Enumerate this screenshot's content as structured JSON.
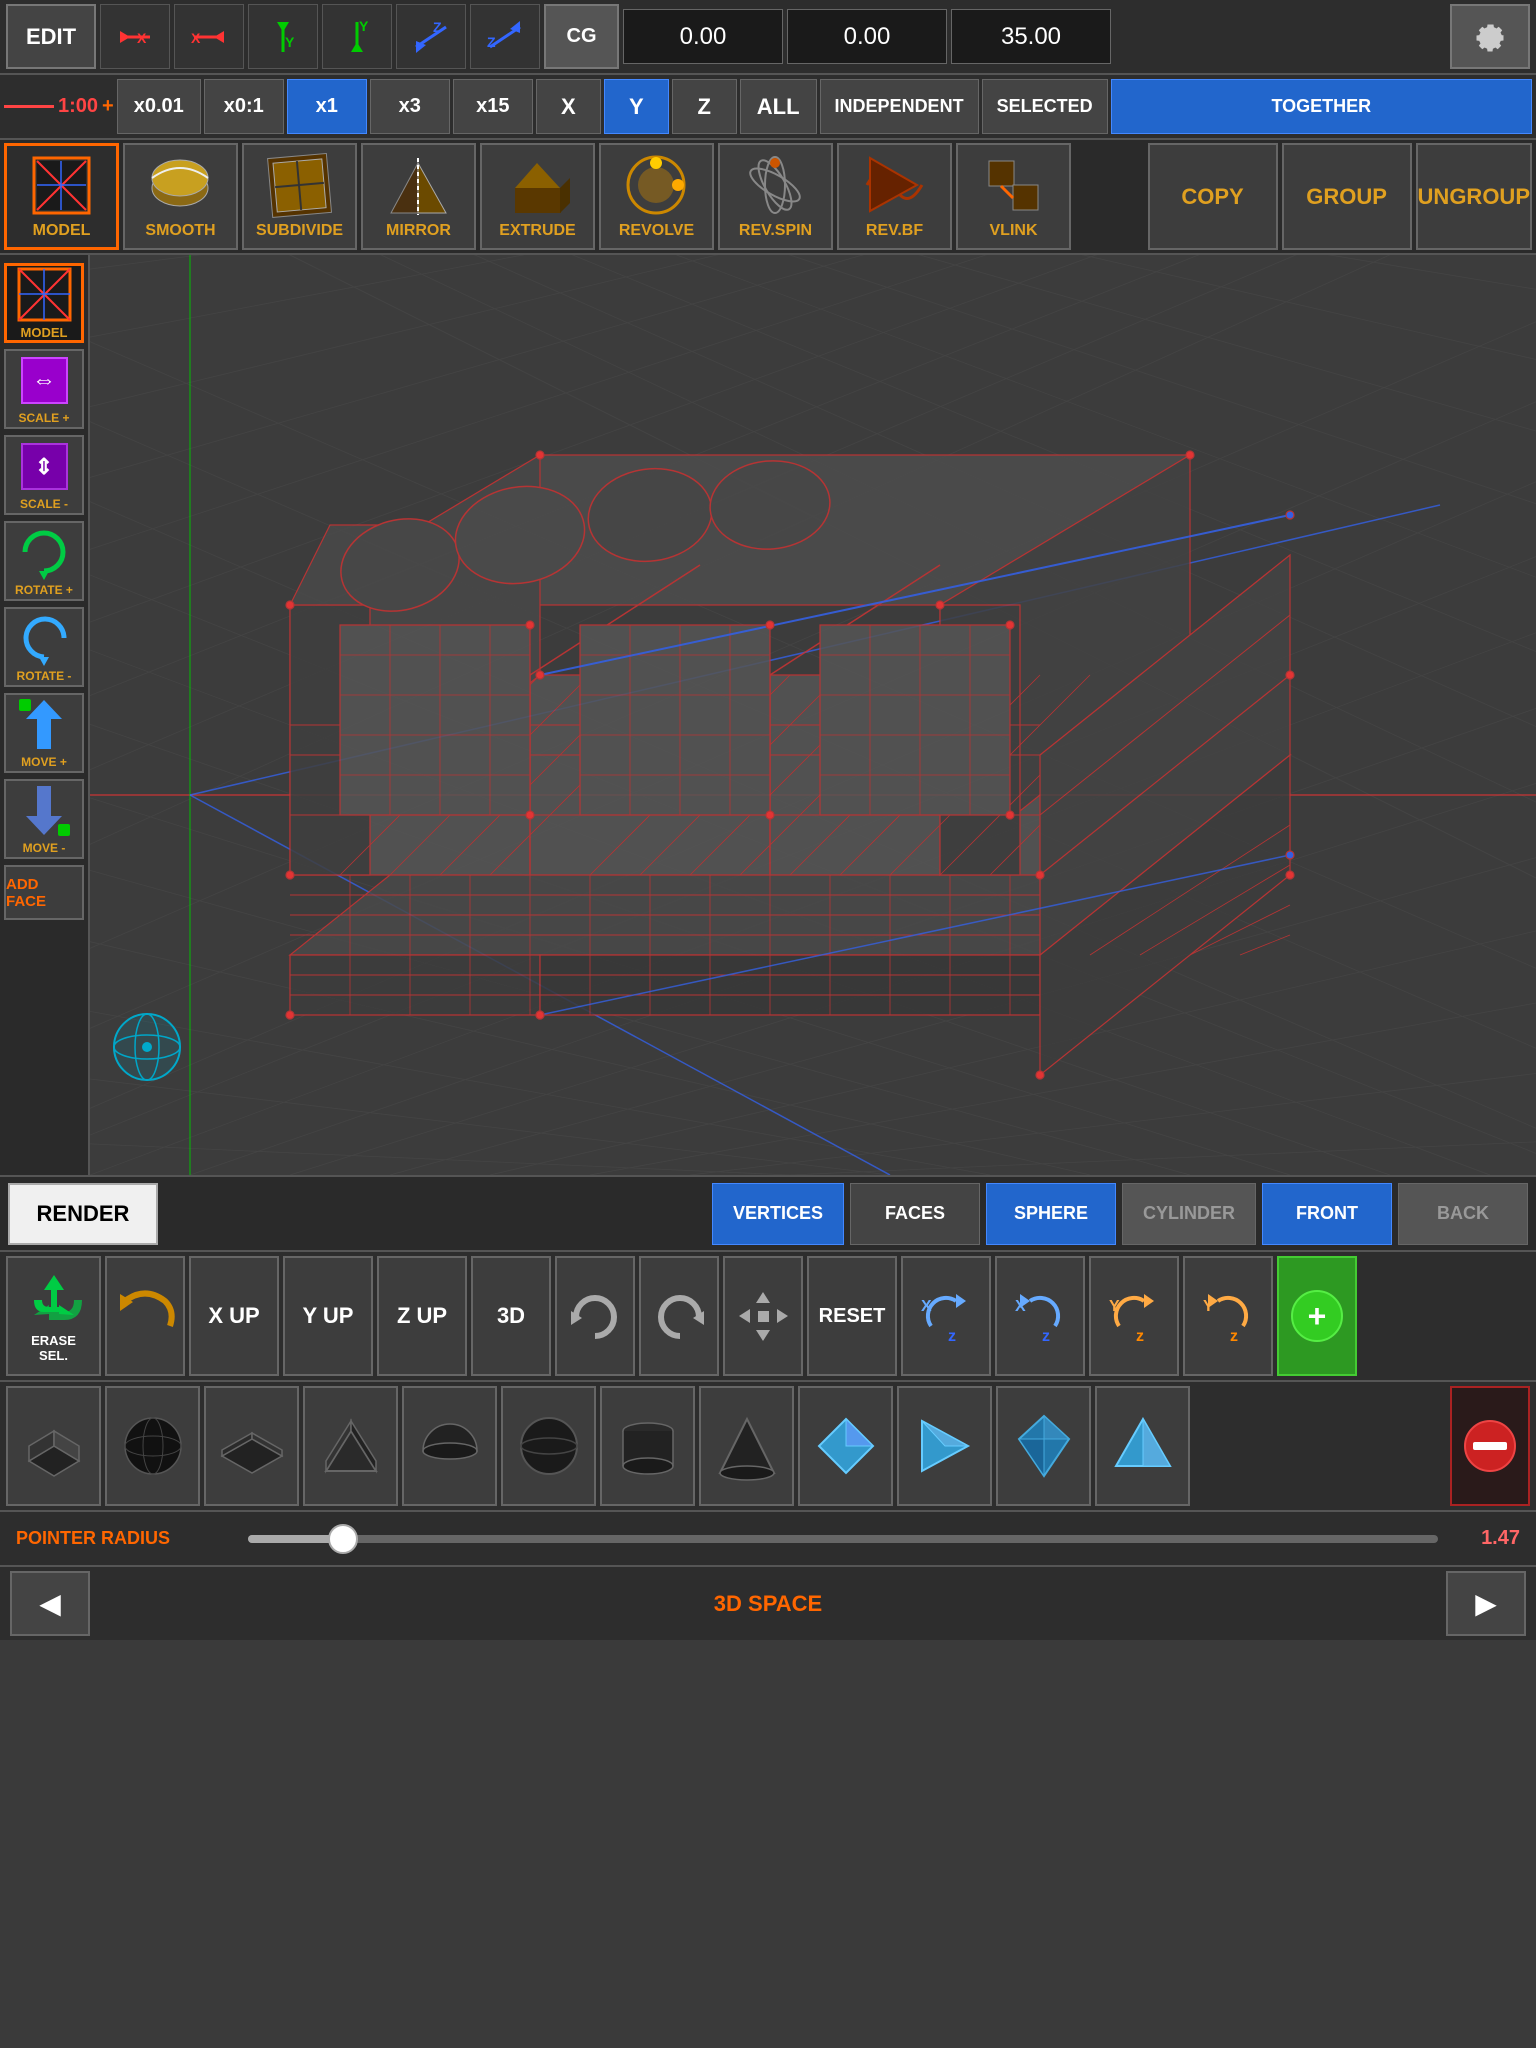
{
  "header": {
    "edit_label": "EDIT",
    "cg_label": "CG",
    "x_coord": "0.00",
    "y_coord": "0.00",
    "z_coord": "35.00",
    "axis_x_neg": "X",
    "axis_x_pos": "X",
    "axis_y_neg": "Y",
    "axis_y_pos": "Y",
    "axis_z_neg": "Z",
    "axis_z_pos": "Z"
  },
  "second_bar": {
    "scale": "1:00",
    "mult_options": [
      "x0.01",
      "x0:1",
      "x1",
      "x3",
      "x15"
    ],
    "active_mult": "x1",
    "axes": [
      "X",
      "Y",
      "Z",
      "ALL"
    ],
    "active_axis": "Y",
    "modes": [
      "INDEPENDENT",
      "SELECTED",
      "TOGETHER"
    ],
    "active_mode": "TOGETHER"
  },
  "toolbar": {
    "tools": [
      "MODEL",
      "SMOOTH",
      "SUBDIVIDE",
      "MIRROR",
      "EXTRUDE",
      "REVOLVE",
      "REV.SPIN",
      "REV.BF",
      "VLINK"
    ],
    "action_buttons": [
      "COPY",
      "GROUP",
      "UNGROUP"
    ]
  },
  "left_sidebar": {
    "buttons": [
      "SCALE +",
      "SCALE -",
      "ROTATE +",
      "ROTATE -",
      "MOVE +",
      "MOVE -"
    ],
    "add_face": "ADD FACE"
  },
  "render_bar": {
    "render_label": "RENDER",
    "view_buttons": [
      "VERTICES",
      "FACES",
      "SPHERE",
      "CYLINDER",
      "FRONT",
      "BACK"
    ],
    "active_views": [
      "VERTICES",
      "SPHERE",
      "FRONT"
    ]
  },
  "bottom_toolbar_1": {
    "buttons": [
      {
        "label": "ERASE\nSEL.",
        "icon": "recycle"
      },
      {
        "label": "",
        "icon": "undo-arrow"
      },
      {
        "label": "X UP",
        "icon": ""
      },
      {
        "label": "Y UP",
        "icon": ""
      },
      {
        "label": "Z UP",
        "icon": ""
      },
      {
        "label": "3D",
        "icon": ""
      },
      {
        "label": "",
        "icon": "undo"
      },
      {
        "label": "",
        "icon": "redo"
      },
      {
        "label": "",
        "icon": "move-arrows"
      },
      {
        "label": "RESET",
        "icon": ""
      }
    ],
    "rotation_buttons": [
      "Xz",
      "Xz-",
      "Yz",
      "Yz-"
    ],
    "add_btn": "+"
  },
  "bottom_toolbar_2": {
    "shapes": [
      "flat-quad",
      "sphere",
      "flat-tri",
      "wedge",
      "half-sphere",
      "sphere-full",
      "cylinder",
      "cone",
      "blue-tri",
      "blue-arrow",
      "blue-diamond",
      "blue-pyramid",
      "minus"
    ]
  },
  "pointer_bar": {
    "label": "POINTER RADIUS",
    "value": "1.47",
    "slider_percent": 8
  },
  "nav_bar": {
    "left_arrow": "◀",
    "right_arrow": "▶",
    "center_label": "3D SPACE"
  }
}
